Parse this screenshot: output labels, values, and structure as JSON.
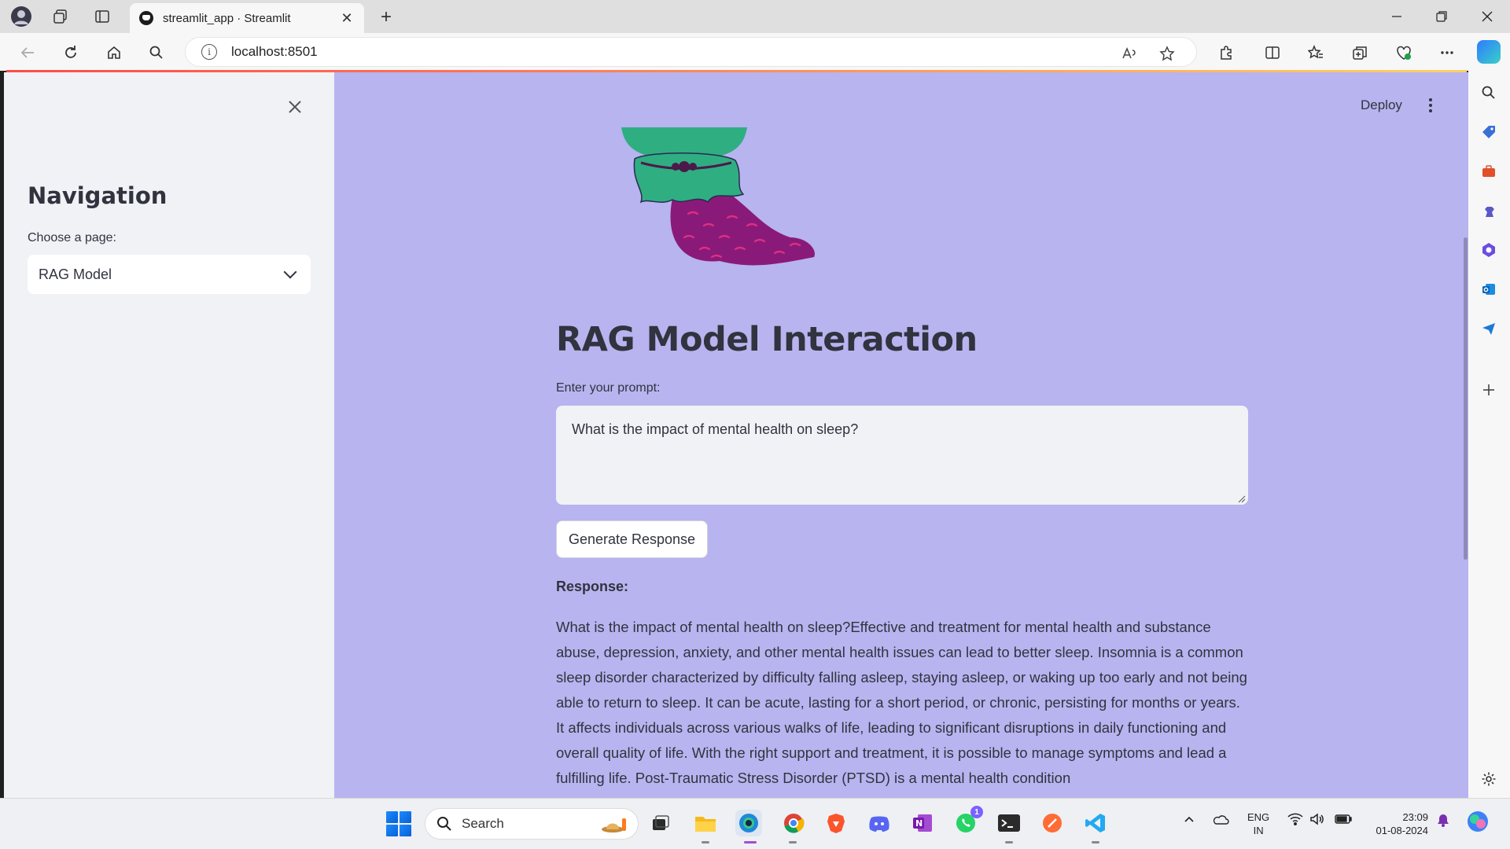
{
  "browser": {
    "tab_title": "streamlit_app · Streamlit",
    "url": "localhost:8501",
    "new_tab": "+",
    "tab_close": "✕"
  },
  "sidebar": {
    "title": "Navigation",
    "select_label": "Choose a page:",
    "select_value": "RAG Model"
  },
  "header": {
    "deploy_label": "Deploy"
  },
  "main": {
    "title": "RAG Model Interaction",
    "prompt_label": "Enter your prompt:",
    "prompt_value": "What is the impact of mental health on sleep?",
    "button_label": "Generate Response",
    "response_label": "Response:",
    "response_text": "What is the impact of mental health on sleep?Effective and treatment for mental health and substance abuse, depression, anxiety, and other mental health issues can lead to better sleep. Insomnia is a common sleep disorder characterized by difficulty falling asleep, staying asleep, or waking up too early and not being able to return to sleep. It can be acute, lasting for a short period, or chronic, persisting for months or years. It affects individuals across various walks of life, leading to significant disruptions in daily functioning and overall quality of life. With the right support and treatment, it is possible to manage symptoms and lead a fulfilling life. Post-Traumatic Stress Disorder (PTSD) is a mental health condition"
  },
  "taskbar": {
    "search_placeholder": "Search",
    "lang_line1": "ENG",
    "lang_line2": "IN",
    "time": "23:09",
    "date": "01-08-2024",
    "whatsapp_badge": "1"
  },
  "colors": {
    "main_bg": "#b7b4ef",
    "sidebar_bg": "#f0f2f6",
    "text": "#31333f",
    "accent": "#ff4b4b"
  }
}
